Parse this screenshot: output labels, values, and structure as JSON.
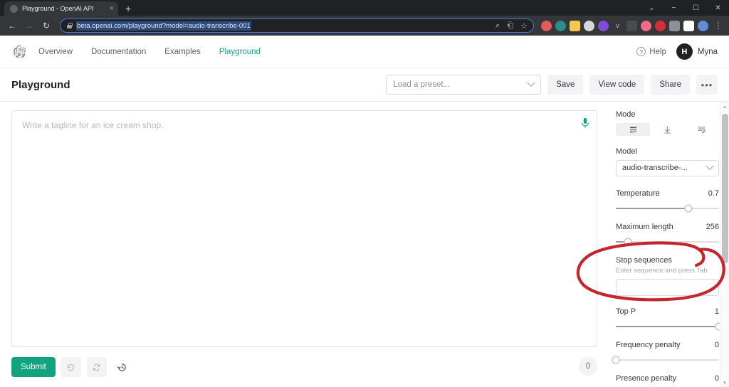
{
  "browser": {
    "tab": {
      "title": "Playground - OpenAI API",
      "favicon": "globe-icon",
      "close": "×"
    },
    "new_tab": "+",
    "window_controls": {
      "minimize_group": "⌄",
      "minimize": "−",
      "maximize": "☐",
      "close": "✕"
    },
    "nav": {
      "back": "←",
      "forward": "→",
      "reload": "↻"
    },
    "url": "beta.openai.com/playground?model=audio-transcribe-001",
    "omnibox_icons": {
      "zoom": "⌕",
      "share": "⎗",
      "bookmark": "☆"
    },
    "menu": "⋮",
    "extensions": [
      {
        "name": "shield-extension-icon",
        "color": "#e05c5c"
      },
      {
        "name": "globe-extension-icon",
        "color": "#2f8c8c"
      },
      {
        "name": "notes-extension-icon",
        "color": "#f5c84c"
      },
      {
        "name": "grey-extension-icon",
        "color": "#d7d7db"
      },
      {
        "name": "purple-extension-icon",
        "color": "#7a4fd6"
      },
      {
        "name": "v-extension-icon",
        "color": "#35363a"
      },
      {
        "name": "phone-extension-icon",
        "color": "#4a4b4f"
      },
      {
        "name": "pink-extension-icon",
        "color": "#f06a8a"
      },
      {
        "name": "red-extension-icon",
        "color": "#d32f3a"
      },
      {
        "name": "puzzle-extension-icon",
        "color": "#8d9096"
      },
      {
        "name": "sidebar-extension-icon",
        "color": "#ffffff"
      },
      {
        "name": "profile-extension-icon",
        "color": "#5b8fd6"
      }
    ]
  },
  "site_header": {
    "logo": "openai-logo",
    "links": [
      {
        "label": "Overview",
        "active": false
      },
      {
        "label": "Documentation",
        "active": false
      },
      {
        "label": "Examples",
        "active": false
      },
      {
        "label": "Playground",
        "active": true
      }
    ],
    "help": {
      "label": "Help",
      "icon": "question-mark-icon"
    },
    "user": {
      "initial": "H",
      "name": "Myna"
    }
  },
  "sub_header": {
    "title": "Playground",
    "preset_placeholder": "Load a preset...",
    "save_label": "Save",
    "view_code_label": "View code",
    "share_label": "Share",
    "more_label": "•••"
  },
  "prompt": {
    "placeholder": "Write a tagline for an ice cream shop.",
    "value": "",
    "mic_icon": "microphone-icon",
    "mic_color": "#10a37f"
  },
  "bottom_bar": {
    "submit_label": "Submit",
    "undo_icon": "undo-arrow-icon",
    "regenerate_icon": "regenerate-icon",
    "history_icon": "history-clock-icon",
    "token_count": "0"
  },
  "settings": {
    "mode": {
      "label": "Mode",
      "tabs": [
        {
          "name": "complete-mode",
          "icon": "complete-icon",
          "active": true
        },
        {
          "name": "insert-mode",
          "icon": "insert-down-arrow-icon",
          "active": false
        },
        {
          "name": "edit-mode",
          "icon": "edit-lines-icon",
          "active": false
        }
      ]
    },
    "model": {
      "label": "Model",
      "value": "audio-transcribe-..."
    },
    "temperature": {
      "label": "Temperature",
      "value": "0.7",
      "percent": 70
    },
    "maximum_length": {
      "label": "Maximum length",
      "value": "256",
      "percent": 12
    },
    "stop_sequences": {
      "label": "Stop sequences",
      "hint": "Enter sequence and press Tab",
      "value": ""
    },
    "top_p": {
      "label": "Top P",
      "value": "1",
      "percent": 100
    },
    "frequency_penalty": {
      "label": "Frequency penalty",
      "value": "0",
      "percent": 0
    },
    "presence_penalty": {
      "label": "Presence penalty",
      "value": "0",
      "percent": 0
    }
  },
  "annotation": {
    "shape": "hand-drawn-red-ellipse",
    "color": "#c4262b",
    "target": "model-dropdown"
  },
  "scrollbar": {
    "up": "▴",
    "down": "▾"
  }
}
